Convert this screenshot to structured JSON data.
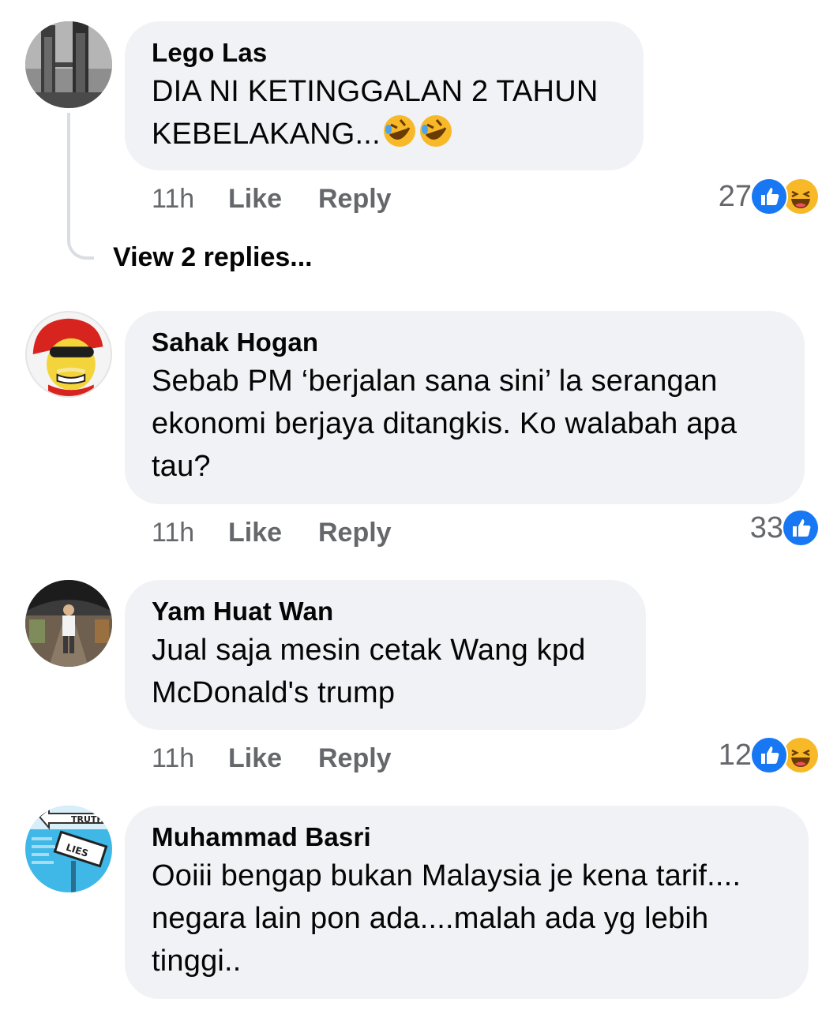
{
  "comments": [
    {
      "author": "Lego Las",
      "text": "DIA NI KETINGGALAN 2 TAHUN\nKEBELAKANG...",
      "emoji_suffix": [
        "rolling-on-floor-laughing-icon",
        "rolling-on-floor-laughing-icon"
      ],
      "time": "11h",
      "like_label": "Like",
      "reply_label": "Reply",
      "reaction_count": "27",
      "reactions": [
        "like-icon",
        "haha-icon"
      ],
      "view_replies": "View 2 replies..."
    },
    {
      "author": "Sahak Hogan",
      "text": "Sebab PM ‘berjalan sana sini’ la serangan\nekonomi berjaya ditangkis. Ko walabah apa\ntau?",
      "time": "11h",
      "like_label": "Like",
      "reply_label": "Reply",
      "reaction_count": "33",
      "reactions": [
        "like-icon"
      ]
    },
    {
      "author": "Yam Huat Wan",
      "text": "Jual saja mesin cetak Wang kpd\nMcDonald's trump",
      "time": "11h",
      "like_label": "Like",
      "reply_label": "Reply",
      "reaction_count": "12",
      "reactions": [
        "like-icon",
        "haha-icon"
      ]
    },
    {
      "author": "Muhammad Basri",
      "text": "Ooiii bengap bukan Malaysia je kena tarif....\nnegara lain pon ada....malah ada yg lebih\ntinggi..",
      "avatar_text": [
        "TRUTH",
        "LIES"
      ]
    }
  ],
  "colors": {
    "bubble": "#f0f2f5",
    "meta": "#65676b",
    "like_blue": "#1877f2",
    "haha_yellow": "#f7b928"
  }
}
